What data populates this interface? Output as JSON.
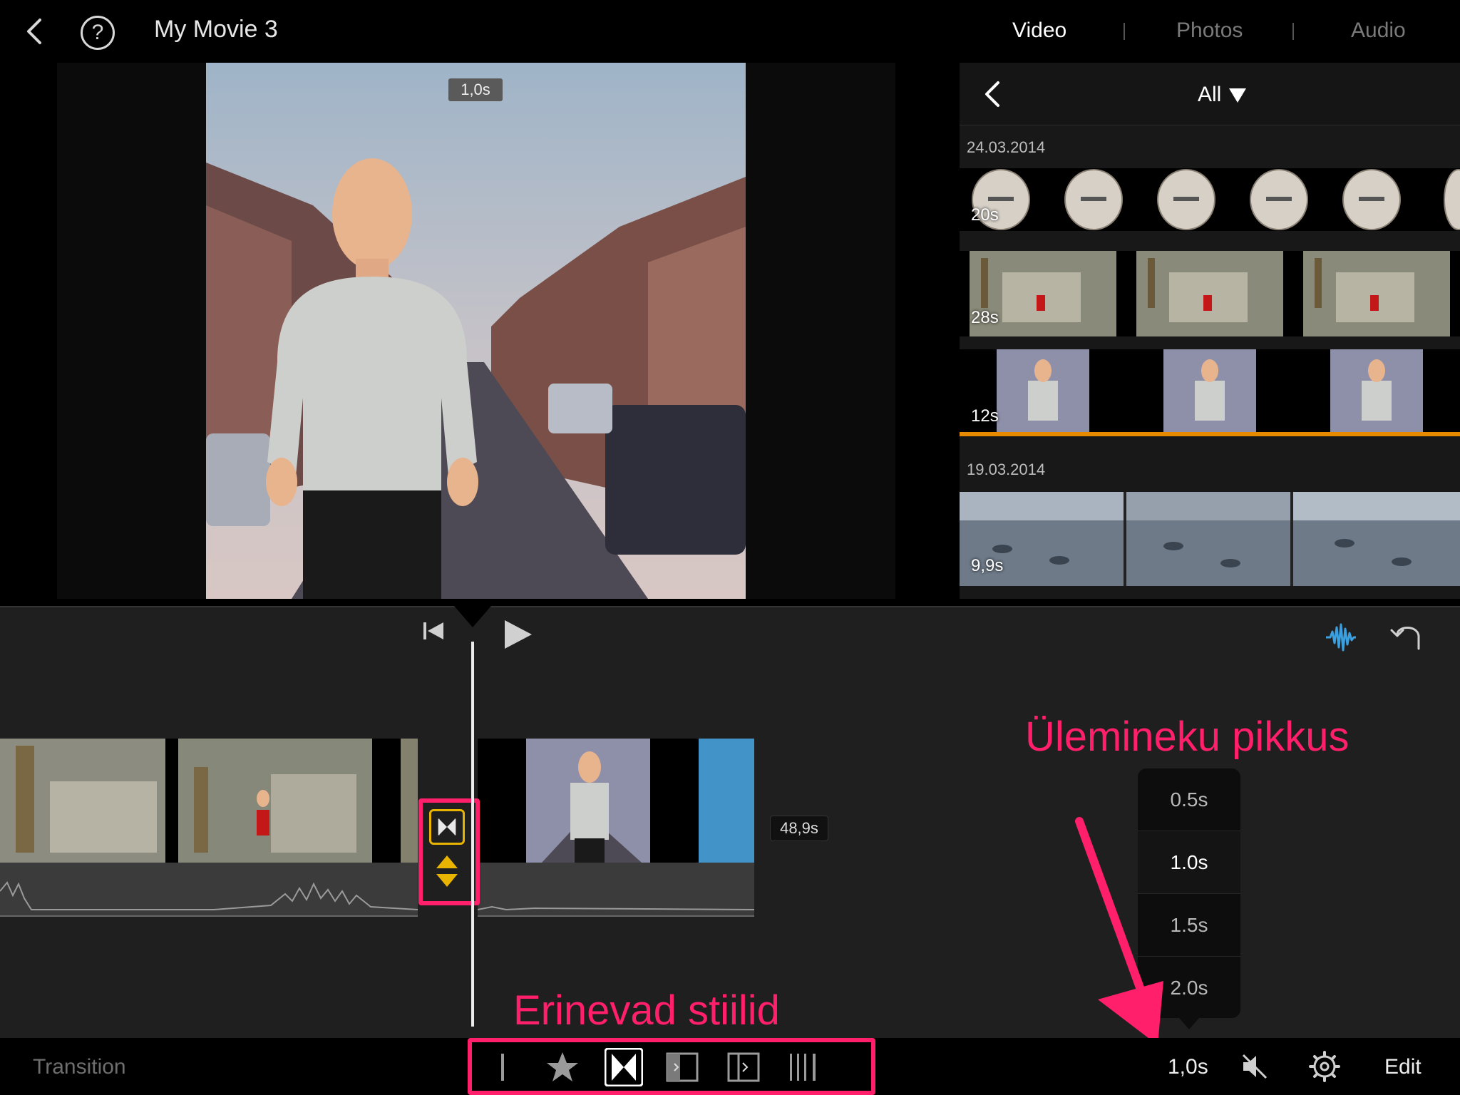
{
  "top_bar": {
    "title": "My Movie 3",
    "help_label": "?",
    "media_tabs": [
      {
        "label": "Video",
        "active": true
      },
      {
        "label": "Photos",
        "active": false
      },
      {
        "label": "Audio",
        "active": false
      }
    ]
  },
  "viewer": {
    "transition_duration": "1,0s"
  },
  "browser": {
    "filter": "All",
    "groups": [
      {
        "date": "24.03.2014",
        "clips": [
          {
            "duration": "20s"
          },
          {
            "duration": "28s"
          },
          {
            "duration": "12s"
          }
        ]
      },
      {
        "date": "19.03.2014",
        "clips": [
          {
            "duration": "9,9s"
          }
        ]
      }
    ]
  },
  "timeline": {
    "total_duration": "48,9s"
  },
  "duration_menu": {
    "options": [
      "0.5s",
      "1.0s",
      "1.5s",
      "2.0s"
    ],
    "selected": "1.0s"
  },
  "annotations": {
    "duration_label": "Ülemineku pikkus",
    "styles_label": "Erinevad stiilid"
  },
  "bottom_bar": {
    "mode_label": "Transition",
    "duration_value": "1,0s",
    "edit_label": "Edit"
  },
  "colors": {
    "accent_annotation": "#ff1f6a",
    "selection_orange": "#e88a00",
    "transition_yellow": "#e8b400",
    "waveform_blue": "#3aa0e0"
  },
  "icons": {
    "back": "chevron-left-icon",
    "help": "question-circle-icon",
    "skip_start": "skip-to-start-icon",
    "play": "play-icon",
    "waveform": "audio-waveform-icon",
    "undo": "undo-icon",
    "mute": "speaker-mute-icon",
    "settings": "gear-icon"
  }
}
